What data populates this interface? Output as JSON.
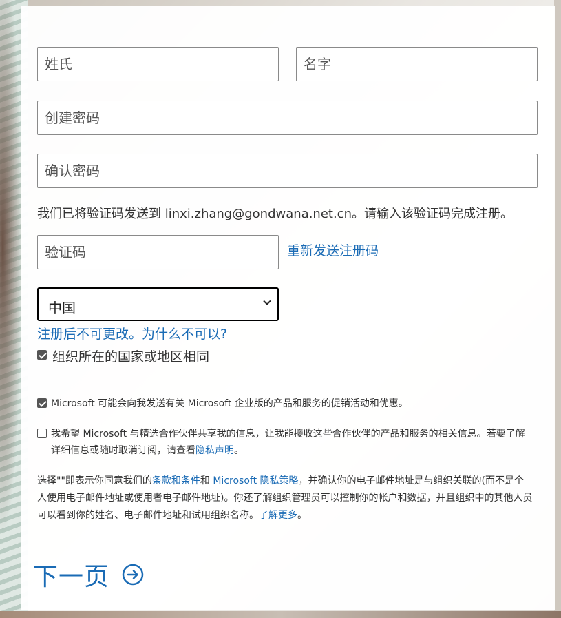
{
  "form": {
    "last_name_placeholder": "姓氏",
    "first_name_placeholder": "名字",
    "create_password_placeholder": "创建密码",
    "confirm_password_placeholder": "确认密码",
    "verification_notice": "我们已将验证码发送到 linxi.zhang@gondwana.net.cn。请输入该验证码完成注册。",
    "verification_code_placeholder": "验证码",
    "resend_link": "重新发送注册码",
    "country_value": "中国",
    "country_note_link": "注册后不可更改。为什么不可以?",
    "same_region_label": "组织所在的国家或地区相同",
    "same_region_checked": true
  },
  "consents": {
    "promo_label": "Microsoft 可能会向我发送有关 Microsoft 企业版的产品和服务的促销活动和优惠。",
    "promo_checked": true,
    "partner_label_1": "我希望 Microsoft 与精选合作伙伴共享我的信息，让我能接收这些合作伙伴的产品和服务的相关信息。若要了解详细信息或随时取消订阅，请查看",
    "partner_privacy_link": "隐私声明",
    "partner_label_end": "。",
    "partner_checked": false
  },
  "legal": {
    "part1": "选择\"\"即表示你同意我们的",
    "terms_link": "条款和条件",
    "part2": "和 ",
    "privacy_link": "Microsoft 隐私策略",
    "part3": "，并确认你的电子邮件地址是与组织关联的(而不是个人使用电子邮件地址或使用者电子邮件地址)。你还了解组织管理员可以控制你的帐户和数据，并且组织中的其他人员可以看到你的姓名、电子邮件地址和试用组织名称。",
    "learn_more_link": "了解更多",
    "part4": "。"
  },
  "next_button": {
    "label": "下一页",
    "icon": "arrow-circle-right-icon"
  },
  "colors": {
    "accent": "#1a6bb5",
    "text": "#333333"
  }
}
